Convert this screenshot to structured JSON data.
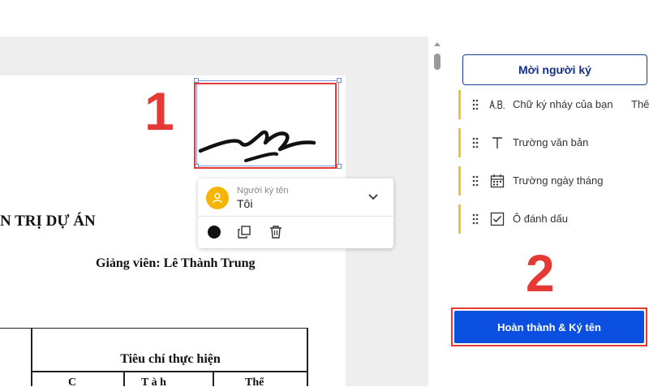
{
  "document": {
    "heading": "N TRỊ DỰ ÁN",
    "lecturer": "Giảng viên: Lê Thành Trung",
    "table_header": "Tiêu chí thực hiện",
    "sub_headers": [
      "C",
      "T     à h",
      "Thế"
    ]
  },
  "steps": {
    "one": "1",
    "two": "2"
  },
  "signer_popup": {
    "caption": "Người ký tên",
    "name": "Tôi",
    "avatar_color": "#f5b400"
  },
  "sidebar": {
    "invite_button": "Mời người ký",
    "fields": [
      {
        "icon": "initials-icon",
        "label": "Chữ ký nháy của bạn",
        "extra": "Thê"
      },
      {
        "icon": "text-icon",
        "label": "Trường văn bản"
      },
      {
        "icon": "calendar-icon",
        "label": "Trường ngày tháng"
      },
      {
        "icon": "checkbox-icon",
        "label": "Ô đánh dấu"
      }
    ],
    "finish_button": "Hoàn thành & Ký tên"
  },
  "colors": {
    "accent_blue": "#0a4fe0",
    "navy": "#123184",
    "highlight_red": "#e53935",
    "field_marker": "#f2c12e"
  }
}
